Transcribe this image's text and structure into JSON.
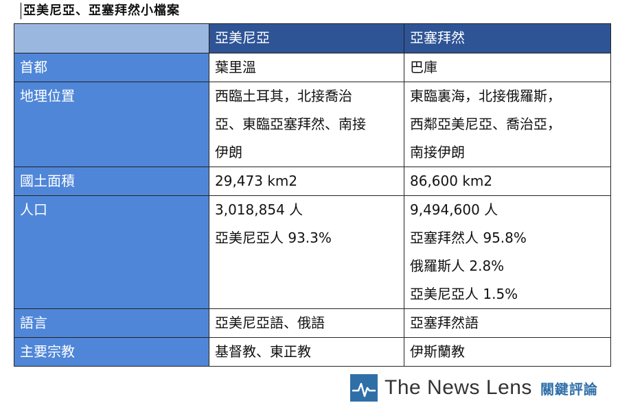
{
  "caption": "亞美尼亞、亞塞拜然小檔案",
  "columns": [
    "",
    "亞美尼亞",
    "亞塞拜然"
  ],
  "rows": [
    {
      "label": "首都",
      "a": [
        "葉里溫"
      ],
      "b": [
        "巴庫"
      ]
    },
    {
      "label": "地理位置",
      "a": [
        "西臨土耳其，北接喬治",
        "亞、東臨亞塞拜然、南接",
        "伊朗"
      ],
      "b": [
        "東臨裏海，北接俄羅斯，",
        "西鄰亞美尼亞、喬治亞，",
        "南接伊朗"
      ]
    },
    {
      "label": "國土面積",
      "a": [
        "29,473 km2"
      ],
      "b": [
        "86,600 km2"
      ]
    },
    {
      "label": "人口",
      "a": [
        "3,018,854 人",
        "亞美尼亞人 93.3%"
      ],
      "b": [
        "9,494,600 人",
        "亞塞拜然人 95.8%",
        "俄羅斯人 2.8%",
        "亞美尼亞人 1.5%"
      ]
    },
    {
      "label": "語言",
      "a": [
        "亞美尼亞語、俄語"
      ],
      "b": [
        "亞塞拜然語"
      ]
    },
    {
      "label": "主要宗教",
      "a": [
        "基督教、東正教"
      ],
      "b": [
        "伊斯蘭教"
      ]
    }
  ],
  "footer": {
    "logo_icon": "pulse-line-icon",
    "brand": "The News Lens",
    "brand_cn": "關鍵評論"
  },
  "colors": {
    "header_bg": "#2e5496",
    "corner_bg": "#9ab7e0",
    "label_bg": "#4f86d8",
    "brand_blue": "#2f6fa8"
  }
}
